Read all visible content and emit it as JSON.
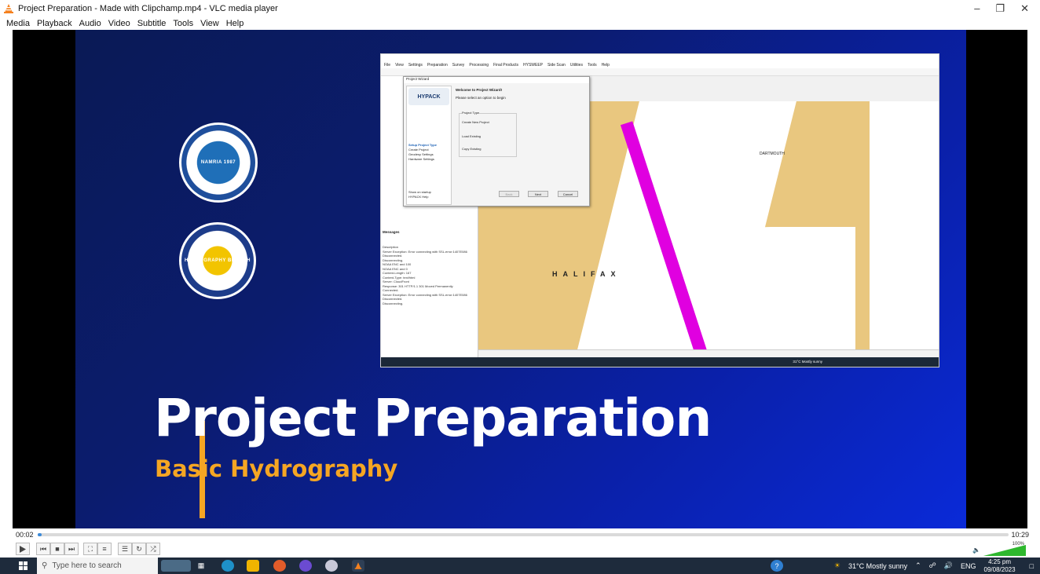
{
  "window": {
    "title": "Project Preparation - Made with Clipchamp.mp4 - VLC media player"
  },
  "menu": [
    "Media",
    "Playback",
    "Audio",
    "Video",
    "Subtitle",
    "Tools",
    "View",
    "Help"
  ],
  "slide": {
    "title": "Project Preparation",
    "subtitle": "Basic Hydrography",
    "seal1_text": "NAMRIA 1987",
    "seal2_text": "HYDROGRAPHY BRANCH",
    "inner": {
      "menu": [
        "File",
        "View",
        "Settings",
        "Preparation",
        "Survey",
        "Processing",
        "Final Products",
        "HYSWEEP",
        "Side Scan",
        "Utilities",
        "Tools",
        "Help"
      ],
      "wizard_title": "Project Wizard",
      "wizard_heading": "Welcome to Project Wizard!",
      "wizard_prompt": "Please select an option to begin",
      "project_type_label": "Project Type",
      "options": [
        "Create New Project",
        "Load Existing",
        "Copy Existing"
      ],
      "steps": [
        "Setup Project Type",
        "Create Project",
        "Geodesy Settings",
        "Hardware Settings"
      ],
      "show_on_startup": "Show on startup",
      "help_label": "HYPACK Help",
      "buttons": [
        "Back",
        "Next",
        "Cancel"
      ],
      "map_labels": [
        "HALIFAX",
        "DARTMOUTH"
      ],
      "logo": "HYPACK",
      "messages_header": "Messages",
      "messages": [
        "Description",
        "Server Exception: Error connecting with SSL.error:1407E086",
        "Disconnected.",
        "Disconnecting.",
        "NOAA ENC and 100",
        "NOAA ENC and 0",
        "Content-Length: 167",
        "Content-Type: text/html",
        "Server: CloudFront",
        "Response: 301 HTTP/1.1 301 Moved Permanently",
        "Connected.",
        "Server Exception: Error connecting with SSL.error:1407E086",
        "Disconnected.",
        "Disconnecting."
      ],
      "taskbar_weather": "31°C Mostly sunny"
    }
  },
  "player": {
    "elapsed": "00:02",
    "total": "10:29",
    "progress": 0.003,
    "volume_label": "100%",
    "volume": 1.0
  },
  "taskbar": {
    "search_placeholder": "Type here to search",
    "weather": "31°C  Mostly sunny",
    "lang": "ENG",
    "time": "4:25 pm",
    "date": "09/08/2023"
  },
  "colors": {
    "accent": "#f5a623",
    "slide_bg": "#0a20a8",
    "seek_fill": "#3b8ad9",
    "taskbar": "#1e2b3c"
  }
}
